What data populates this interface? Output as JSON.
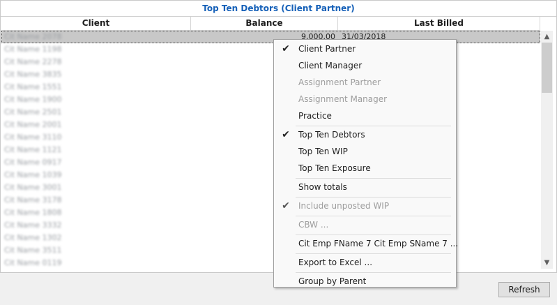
{
  "panel": {
    "title": "Top Ten Debtors (Client Partner)"
  },
  "table": {
    "columns": [
      "Client",
      "Balance",
      "Last Billed"
    ],
    "rows": [
      {
        "client": "Cit Name 2078",
        "balance": "9,000.00",
        "last_billed": "31/03/2018"
      },
      {
        "client": "Cit Name 1198",
        "balance": "",
        "last_billed": ""
      },
      {
        "client": "Cit Name 2278",
        "balance": "",
        "last_billed": ""
      },
      {
        "client": "Cit Name 3835",
        "balance": "",
        "last_billed": ""
      },
      {
        "client": "Cit Name 1551",
        "balance": "",
        "last_billed": ""
      },
      {
        "client": "Cit Name 1900",
        "balance": "",
        "last_billed": ""
      },
      {
        "client": "Cit Name 2501",
        "balance": "",
        "last_billed": ""
      },
      {
        "client": "Cit Name 2001",
        "balance": "",
        "last_billed": ""
      },
      {
        "client": "Cit Name 3110",
        "balance": "",
        "last_billed": ""
      },
      {
        "client": "Cit Name 1121",
        "balance": "",
        "last_billed": ""
      },
      {
        "client": "Cit Name 0917",
        "balance": "",
        "last_billed": ""
      },
      {
        "client": "Cit Name 1039",
        "balance": "",
        "last_billed": ""
      },
      {
        "client": "Cit Name 3001",
        "balance": "",
        "last_billed": ""
      },
      {
        "client": "Cit Name 3178",
        "balance": "",
        "last_billed": ""
      },
      {
        "client": "Cit Name 1808",
        "balance": "",
        "last_billed": ""
      },
      {
        "client": "Cit Name 3332",
        "balance": "",
        "last_billed": ""
      },
      {
        "client": "Cit Name 1302",
        "balance": "",
        "last_billed": ""
      },
      {
        "client": "Cit Name 3511",
        "balance": "",
        "last_billed": ""
      },
      {
        "client": "Cit Name 0119",
        "balance": "",
        "last_billed": ""
      }
    ]
  },
  "context_menu": {
    "items": [
      {
        "label": "Client Partner",
        "checked": true,
        "disabled": false
      },
      {
        "label": "Client Manager",
        "checked": false,
        "disabled": false
      },
      {
        "label": "Assignment Partner",
        "checked": false,
        "disabled": true
      },
      {
        "label": "Assignment Manager",
        "checked": false,
        "disabled": true
      },
      {
        "label": "Practice",
        "checked": false,
        "disabled": false
      },
      {
        "label": "Top Ten Debtors",
        "checked": true,
        "disabled": false
      },
      {
        "label": "Top Ten WIP",
        "checked": false,
        "disabled": false
      },
      {
        "label": "Top Ten Exposure",
        "checked": false,
        "disabled": false
      },
      {
        "label": "Show totals",
        "checked": false,
        "disabled": false
      },
      {
        "label": "Include unposted WIP",
        "checked": true,
        "disabled": true
      },
      {
        "label": "CBW ...",
        "checked": false,
        "disabled": true
      },
      {
        "label": "Cit Emp FName 7 Cit Emp SName 7 ...",
        "checked": false,
        "disabled": false
      },
      {
        "label": "Export to Excel ...",
        "checked": false,
        "disabled": false
      },
      {
        "label": "Group by Parent",
        "checked": false,
        "disabled": false
      }
    ]
  },
  "footer": {
    "refresh_label": "Refresh"
  },
  "colors": {
    "title": "#1560b8",
    "selected_row": "#c8c8c8"
  }
}
